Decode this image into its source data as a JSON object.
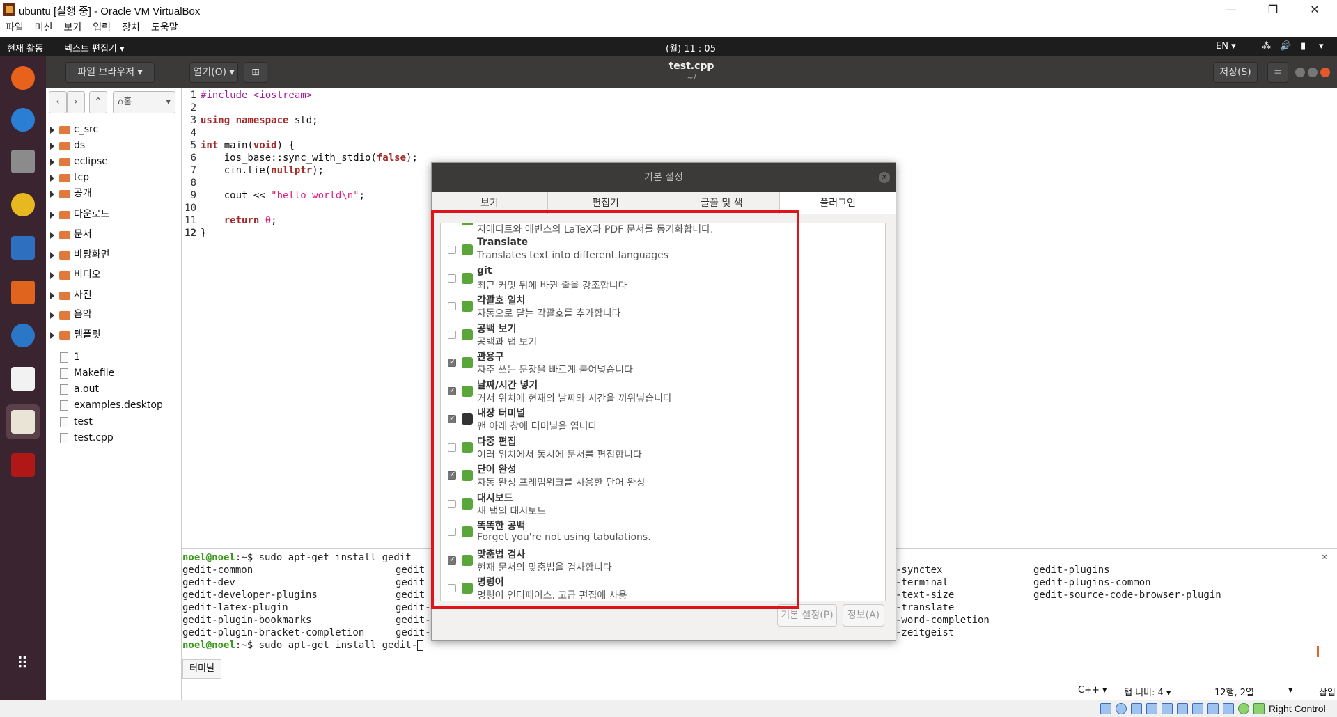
{
  "window": {
    "title": "ubuntu [실행 중] - Oracle VM VirtualBox"
  },
  "vb_menu": [
    "파일",
    "머신",
    "보기",
    "입력",
    "장치",
    "도움말"
  ],
  "topbar": {
    "activities": "현재 활동",
    "app_menu": "텍스트 편집기 ▾",
    "clock": "(월) 11 : 05",
    "lang": "EN ▾"
  },
  "header": {
    "file_browser": "파일 브라우저",
    "open": "열기(O)",
    "filename": "test.cpp",
    "path": "~/",
    "save": "저장(S)"
  },
  "side": {
    "home": "홈",
    "items": [
      {
        "label": "c_src",
        "type": "folder"
      },
      {
        "label": "ds",
        "type": "folder"
      },
      {
        "label": "eclipse",
        "type": "folder"
      },
      {
        "label": "tcp",
        "type": "folder"
      },
      {
        "label": "공개",
        "type": "folder"
      },
      {
        "label": "다운로드",
        "type": "folder"
      },
      {
        "label": "문서",
        "type": "folder"
      },
      {
        "label": "바탕화면",
        "type": "folder"
      },
      {
        "label": "비디오",
        "type": "folder"
      },
      {
        "label": "사진",
        "type": "folder"
      },
      {
        "label": "음악",
        "type": "folder"
      },
      {
        "label": "템플릿",
        "type": "folder"
      },
      {
        "label": "1",
        "type": "file"
      },
      {
        "label": "Makefile",
        "type": "file"
      },
      {
        "label": "a.out",
        "type": "file"
      },
      {
        "label": "examples.desktop",
        "type": "file"
      },
      {
        "label": "test",
        "type": "file"
      },
      {
        "label": "test.cpp",
        "type": "file"
      }
    ]
  },
  "code": {
    "line_numbers": [
      "1",
      "2",
      "3",
      "4",
      "5",
      "6",
      "7",
      "8",
      "9",
      "10",
      "11",
      "12"
    ],
    "l1a": "#include ",
    "l1b": "<iostream>",
    "l3a": "using namespace",
    "l3b": " std;",
    "l5a": "int",
    "l5b": " main(",
    "l5c": "void",
    "l5d": ") {",
    "l6a": "    ios_base::sync_with_stdio(",
    "l6b": "false",
    "l6c": ");",
    "l7a": "    cin.tie(",
    "l7b": "nullptr",
    "l7c": ");",
    "l9a": "    cout << ",
    "l9b": "\"hello world\\n\"",
    "l9c": ";",
    "l11a": "    ",
    "l11b": "return",
    "l11c": " ",
    "l11d": "0",
    "l11e": ";",
    "l12": "}"
  },
  "terminal": {
    "prompt": "noel@noel",
    "cmd1": ":~$ sudo apt-get install gedit",
    "cmd2": ":~$ sudo apt-get install gedit-",
    "col1": [
      "gedit-common",
      "gedit-dev",
      "gedit-developer-plugins",
      "gedit-latex-plugin",
      "gedit-plugin-bookmarks",
      "gedit-plugin-bracket-completion"
    ],
    "col2": [
      "gedit",
      "gedit",
      "gedit",
      "gedit-",
      "gedit-",
      "gedit-"
    ],
    "col3": [
      "-synctex",
      "-terminal",
      "-text-size",
      "-translate",
      "-word-completion",
      "-zeitgeist"
    ],
    "col4": [
      "gedit-plugins",
      "gedit-plugins-common",
      "gedit-source-code-browser-plugin"
    ],
    "close": "×",
    "tab": "터미널"
  },
  "status": {
    "lang": "C++ ▾",
    "tab_width": "탭 너비: 4 ▾",
    "position": "12행, 2열",
    "mode": "삽입"
  },
  "vb_bottom": {
    "host_key": "Right Control"
  },
  "dialog": {
    "title": "기본 설정",
    "tabs": [
      "보기",
      "편집기",
      "글꼴 및 색",
      "플러그인"
    ],
    "top_desc": "지에디트와 에빈스의 LaTeX과 PDF 문서를 동기화합니다.",
    "plugins": [
      {
        "name": "Translate",
        "desc": "Translates text into different languages",
        "checked": false
      },
      {
        "name": "git",
        "desc": "최근 커밋 뒤에 바뀐 줄을 강조합니다",
        "checked": false
      },
      {
        "name": "각괄호 일치",
        "desc": "자동으로 닫는 각괄호를 추가합니다",
        "checked": false
      },
      {
        "name": "공백 보기",
        "desc": "공백과 탭 보기",
        "checked": false
      },
      {
        "name": "관용구",
        "desc": "자주 쓰는 문장을 빠르게 붙여넣습니다",
        "checked": true
      },
      {
        "name": "날짜/시간 넣기",
        "desc": "커서 위치에 현재의 날짜와 시간을 끼워넣습니다",
        "checked": true
      },
      {
        "name": "내장 터미널",
        "desc": "맨 아래 창에 터미널을 엽니다",
        "checked": true
      },
      {
        "name": "다중 편집",
        "desc": "여러 위치에서 동시에 문서를 편집합니다",
        "checked": false
      },
      {
        "name": "단어 완성",
        "desc": "자동 완성 프레임워크를 사용한 단어 완성",
        "checked": true
      },
      {
        "name": "대시보드",
        "desc": "새 탭의 대시보드",
        "checked": false
      },
      {
        "name": "똑똑한 공백",
        "desc": "Forget you're not using tabulations.",
        "checked": false
      },
      {
        "name": "맞춤법 검사",
        "desc": "현재 문서의 맞춤법을 검사합니다",
        "checked": true
      },
      {
        "name": "명령어",
        "desc": "명령어 인터페이스, 고급 편집에 사용",
        "checked": false
      }
    ],
    "prefs_btn": "기본 설정(P)",
    "about_btn": "정보(A)"
  }
}
